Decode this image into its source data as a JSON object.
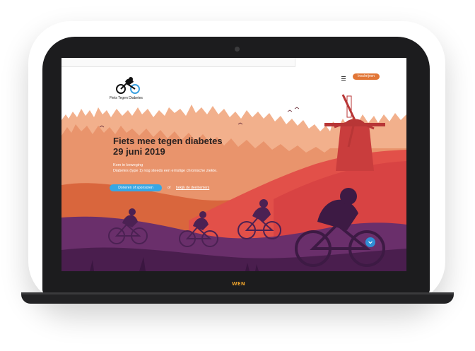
{
  "device": {
    "brand_logo": "WEN"
  },
  "site": {
    "name": "Fiets Tegen Diabetes",
    "menu_icon": "hamburger-icon",
    "signup_label": "Inschrijven"
  },
  "hero": {
    "title_line1": "Fiets mee tegen diabetes",
    "title_line2": "29 juni 2019",
    "sub_line1": "Kom in beweging",
    "sub_line2": "Diabetes (type 1) nog steeds een ernstige chronische ziekte.",
    "donate_label": "Doneren of sponsoren",
    "or_text": "of",
    "participants_link": "bekijk de deelnemers"
  },
  "colors": {
    "accent_orange": "#e27636",
    "accent_blue": "#38a7e4",
    "sky_top": "#ffffff",
    "trees_light": "#f0a07a",
    "hill_orange": "#d9663d",
    "hill_red": "#e0504a",
    "ground_purple": "#6a2f6b",
    "ground_dark": "#4a1e4e"
  }
}
